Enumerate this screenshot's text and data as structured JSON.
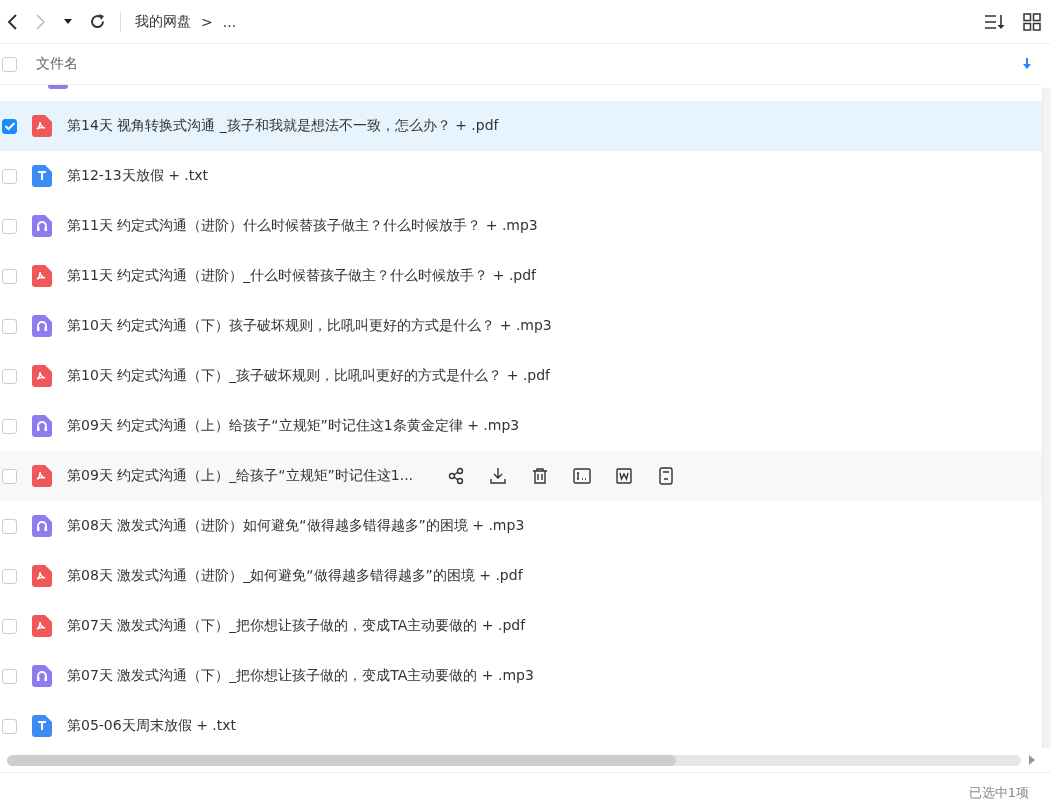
{
  "toolbar": {
    "breadcrumb": [
      {
        "label": "我的网盘"
      },
      {
        "label": "..."
      }
    ],
    "separator": ">"
  },
  "header": {
    "checked": false,
    "column": "文件名"
  },
  "partial_row": {
    "kind": "audio"
  },
  "rows": [
    {
      "kind": "pdf",
      "name": "第14天 视角转换式沟通 _孩子和我就是想法不一致，怎么办？ + .pdf",
      "selected": true,
      "hovered": false
    },
    {
      "kind": "txt",
      "name": "第12-13天放假 + .txt",
      "selected": false,
      "hovered": false
    },
    {
      "kind": "audio",
      "name": "第11天 约定式沟通（进阶）什么时候替孩子做主？什么时候放手？ + .mp3",
      "selected": false,
      "hovered": false
    },
    {
      "kind": "pdf",
      "name": "第11天 约定式沟通（进阶）_什么时候替孩子做主？什么时候放手？ + .pdf",
      "selected": false,
      "hovered": false
    },
    {
      "kind": "audio",
      "name": "第10天 约定式沟通（下）孩子破坏规则，比吼叫更好的方式是什么？ + .mp3",
      "selected": false,
      "hovered": false
    },
    {
      "kind": "pdf",
      "name": "第10天 约定式沟通（下）_孩子破坏规则，比吼叫更好的方式是什么？ + .pdf",
      "selected": false,
      "hovered": false
    },
    {
      "kind": "audio",
      "name": "第09天 约定式沟通（上）给孩子“立规矩”时记住这1条黄金定律 + .mp3",
      "selected": false,
      "hovered": false
    },
    {
      "kind": "pdf",
      "name": "第09天 约定式沟通（上）_给孩子“立规矩”时记住这1...",
      "selected": false,
      "hovered": true
    },
    {
      "kind": "audio",
      "name": "第08天 激发式沟通（进阶）如何避免“做得越多错得越多”的困境 + .mp3",
      "selected": false,
      "hovered": false
    },
    {
      "kind": "pdf",
      "name": "第08天 激发式沟通（进阶）_如何避免“做得越多错得越多”的困境 + .pdf",
      "selected": false,
      "hovered": false
    },
    {
      "kind": "pdf",
      "name": "第07天 激发式沟通（下）_把你想让孩子做的，变成TA主动要做的 + .pdf",
      "selected": false,
      "hovered": false
    },
    {
      "kind": "audio",
      "name": "第07天 激发式沟通（下）_把你想让孩子做的，变成TA主动要做的 + .mp3",
      "selected": false,
      "hovered": false
    },
    {
      "kind": "txt",
      "name": "第05-06天周末放假 + .txt",
      "selected": false,
      "hovered": false
    }
  ],
  "status": "已选中1项"
}
